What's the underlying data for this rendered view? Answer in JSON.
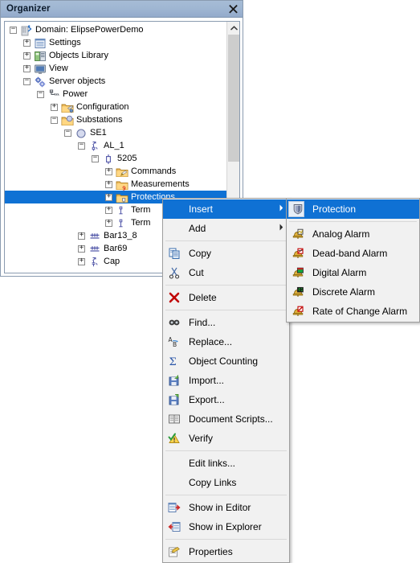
{
  "window": {
    "title": "Organizer",
    "close_label": "×",
    "close_icon": "close-icon"
  },
  "tree": {
    "nodes": [
      {
        "label": "Domain: ElipsePowerDemo",
        "depth": 0,
        "state": "expanded",
        "icon": "domain-icon",
        "selected": false
      },
      {
        "label": "Settings",
        "depth": 1,
        "state": "collapsed",
        "icon": "settings-icon",
        "selected": false
      },
      {
        "label": "Objects Library",
        "depth": 1,
        "state": "collapsed",
        "icon": "objects-library-icon",
        "selected": false
      },
      {
        "label": "View",
        "depth": 1,
        "state": "collapsed",
        "icon": "view-icon",
        "selected": false
      },
      {
        "label": "Server objects",
        "depth": 1,
        "state": "expanded",
        "icon": "server-objects-icon",
        "selected": false
      },
      {
        "label": "Power",
        "depth": 2,
        "state": "expanded",
        "icon": "power-icon",
        "selected": false
      },
      {
        "label": "Configuration",
        "depth": 3,
        "state": "collapsed",
        "icon": "configuration-folder-icon",
        "selected": false
      },
      {
        "label": "Substations",
        "depth": 3,
        "state": "expanded",
        "icon": "substations-folder-icon",
        "selected": false
      },
      {
        "label": "SE1",
        "depth": 4,
        "state": "expanded",
        "icon": "substation-icon",
        "selected": false
      },
      {
        "label": "AL_1",
        "depth": 5,
        "state": "expanded",
        "icon": "bay-icon",
        "selected": false
      },
      {
        "label": "5205",
        "depth": 6,
        "state": "expanded",
        "icon": "device-icon",
        "selected": false
      },
      {
        "label": "Commands",
        "depth": 7,
        "state": "collapsed",
        "icon": "commands-folder-icon",
        "selected": false
      },
      {
        "label": "Measurements",
        "depth": 7,
        "state": "collapsed",
        "icon": "measurements-folder-icon",
        "selected": false
      },
      {
        "label": "Protections",
        "depth": 7,
        "state": "collapsed",
        "icon": "protections-folder-icon",
        "selected": true
      },
      {
        "label": "Term",
        "depth": 7,
        "state": "collapsed",
        "icon": "terminal-icon",
        "selected": false
      },
      {
        "label": "Term",
        "depth": 7,
        "state": "collapsed",
        "icon": "terminal-icon",
        "selected": false
      },
      {
        "label": "Bar13_8",
        "depth": 5,
        "state": "collapsed",
        "icon": "bar-icon",
        "selected": false
      },
      {
        "label": "Bar69",
        "depth": 5,
        "state": "collapsed",
        "icon": "bar-icon",
        "selected": false
      },
      {
        "label": "Cap",
        "depth": 5,
        "state": "collapsed",
        "icon": "capacitor-icon",
        "selected": false
      }
    ],
    "scrollbar": {
      "up_icon": "chevron-up-icon"
    }
  },
  "context_menu": {
    "items": [
      {
        "type": "item",
        "label": "Insert",
        "icon": "none",
        "submenu": true,
        "highlighted": true
      },
      {
        "type": "item",
        "label": "Add",
        "icon": "none",
        "submenu": true,
        "highlighted": false
      },
      {
        "type": "separator"
      },
      {
        "type": "item",
        "label": "Copy",
        "icon": "copy-icon",
        "submenu": false,
        "highlighted": false
      },
      {
        "type": "item",
        "label": "Cut",
        "icon": "cut-icon",
        "submenu": false,
        "highlighted": false
      },
      {
        "type": "separator"
      },
      {
        "type": "item",
        "label": "Delete",
        "icon": "delete-icon",
        "submenu": false,
        "highlighted": false
      },
      {
        "type": "separator"
      },
      {
        "type": "item",
        "label": "Find...",
        "icon": "find-icon",
        "submenu": false,
        "highlighted": false
      },
      {
        "type": "item",
        "label": "Replace...",
        "icon": "replace-icon",
        "submenu": false,
        "highlighted": false
      },
      {
        "type": "item",
        "label": "Object Counting",
        "icon": "object-counting-icon",
        "submenu": false,
        "highlighted": false
      },
      {
        "type": "item",
        "label": "Import...",
        "icon": "import-icon",
        "submenu": false,
        "highlighted": false
      },
      {
        "type": "item",
        "label": "Export...",
        "icon": "export-icon",
        "submenu": false,
        "highlighted": false
      },
      {
        "type": "item",
        "label": "Document Scripts...",
        "icon": "document-scripts-icon",
        "submenu": false,
        "highlighted": false
      },
      {
        "type": "item",
        "label": "Verify",
        "icon": "verify-icon",
        "submenu": false,
        "highlighted": false
      },
      {
        "type": "separator"
      },
      {
        "type": "item",
        "label": "Edit links...",
        "icon": "none",
        "submenu": false,
        "highlighted": false
      },
      {
        "type": "item",
        "label": "Copy Links",
        "icon": "none",
        "submenu": false,
        "highlighted": false
      },
      {
        "type": "separator"
      },
      {
        "type": "item",
        "label": "Show in Editor",
        "icon": "show-in-editor-icon",
        "submenu": false,
        "highlighted": false
      },
      {
        "type": "item",
        "label": "Show in Explorer",
        "icon": "show-in-explorer-icon",
        "submenu": false,
        "highlighted": false
      },
      {
        "type": "separator"
      },
      {
        "type": "item",
        "label": "Properties",
        "icon": "properties-icon",
        "submenu": false,
        "highlighted": false
      }
    ]
  },
  "submenu": {
    "items": [
      {
        "label": "Protection",
        "icon": "protection-shield-icon",
        "highlighted": true
      },
      {
        "type": "separator"
      },
      {
        "label": "Analog Alarm",
        "icon": "analog-alarm-icon",
        "highlighted": false
      },
      {
        "label": "Dead-band Alarm",
        "icon": "deadband-alarm-icon",
        "highlighted": false
      },
      {
        "label": "Digital Alarm",
        "icon": "digital-alarm-icon",
        "highlighted": false
      },
      {
        "label": "Discrete Alarm",
        "icon": "discrete-alarm-icon",
        "highlighted": false
      },
      {
        "label": "Rate of Change Alarm",
        "icon": "rate-of-change-alarm-icon",
        "highlighted": false
      }
    ]
  },
  "colors": {
    "selection": "#0f71d4",
    "title_bar": "#9fb6d2",
    "menu_bg": "#f1f1f1",
    "panel_border": "#8a9bb0"
  }
}
